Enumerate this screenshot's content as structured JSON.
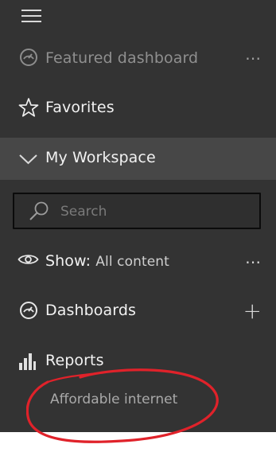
{
  "nav": {
    "menu_icon": "hamburger-menu-icon",
    "featured": {
      "icon": "gauge-icon",
      "label": "Featured dashboard",
      "more": "⋯"
    },
    "favorites": {
      "icon": "star-outline-icon",
      "label": "Favorites"
    },
    "workspace": {
      "icon": "chevron-down-icon",
      "label": "My Workspace"
    },
    "search": {
      "icon": "search-icon",
      "placeholder": "Search"
    },
    "show": {
      "icon": "eye-icon",
      "label": "Show:",
      "value": "All content",
      "more": "⋯"
    },
    "dashboards": {
      "icon": "gauge-icon",
      "label": "Dashboards",
      "add": "+"
    },
    "reports": {
      "icon": "bar-chart-icon",
      "label": "Reports",
      "items": [
        "Affordable internet"
      ]
    }
  },
  "colors": {
    "pane": "#333333",
    "selected_row": "#474747",
    "text": "#f2f2f2",
    "muted_text": "#a9a9a9",
    "search_border": "#0b0b0b",
    "annotation": "#e0222a"
  }
}
